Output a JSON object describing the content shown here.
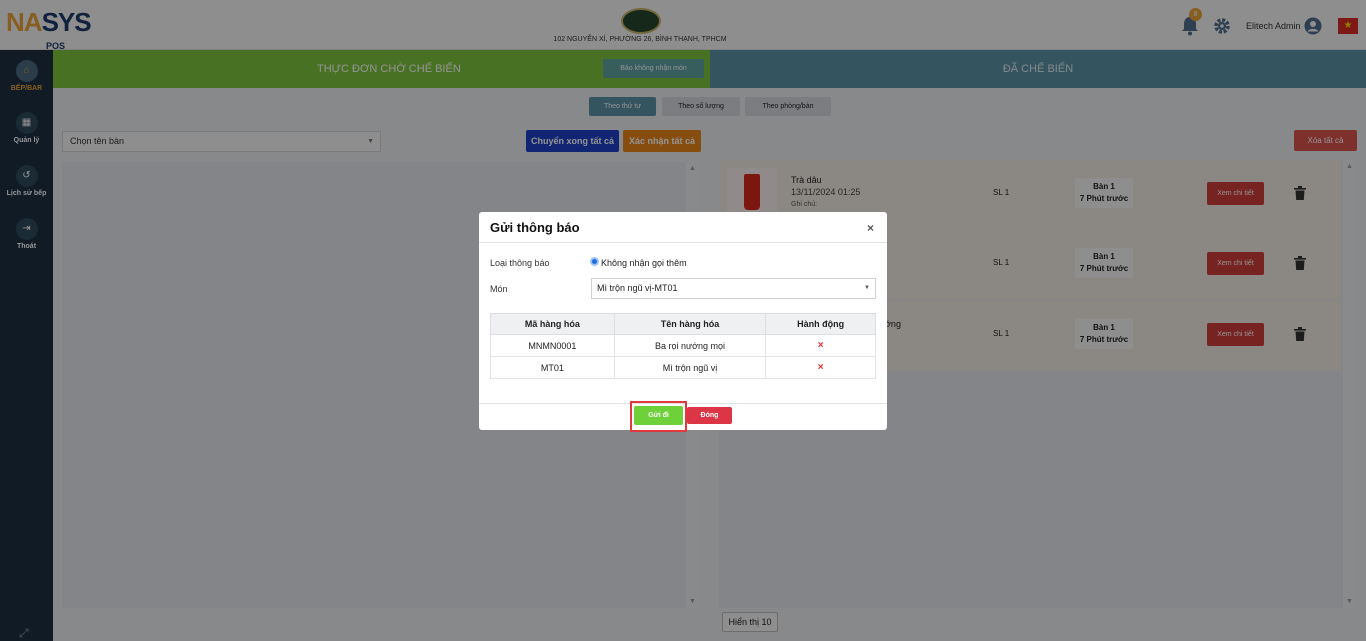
{
  "header": {
    "logo_part1": "NA",
    "logo_part2": "SYS",
    "logo_sub": "POS",
    "address": "102 NGUYỄN XÍ, PHƯỜNG 26, BÌNH THẠNH, TPHCM",
    "notification_count": "8",
    "user_name": "Elitech Admin",
    "flag_star": "★"
  },
  "sidebar": {
    "items": [
      {
        "label": "BẾP/BAR",
        "icon": "⌂"
      },
      {
        "label": "Quản lý",
        "icon": "▦"
      },
      {
        "label": "Lịch sử bếp",
        "icon": "↺"
      },
      {
        "label": "Thoát",
        "icon": "⇥"
      }
    ],
    "expand_icon": "⤢"
  },
  "tabs": {
    "pending_title": "THỰC ĐƠN CHỜ CHẾ BIẾN",
    "report_button": "Báo không nhận món",
    "done_title": "ĐÃ CHẾ BIẾN"
  },
  "sub_tabs": [
    "Theo thứ tự",
    "Theo số lượng",
    "Theo phòng/bàn"
  ],
  "toolbar": {
    "table_select_placeholder": "Chọn tên bàn",
    "done_all": "Chuyển xong tất cả",
    "confirm_all": "Xác nhận tất cả",
    "delete_all": "Xóa tất cả"
  },
  "orders": [
    {
      "name": "Trà dâu",
      "time": "13/11/2024 01:25",
      "note": "Ghi chú:",
      "qty": "SL 1",
      "table": "Bàn 1",
      "ago": "7 Phút trước",
      "detail": "Xem chi tiết"
    },
    {
      "name": "",
      "time": "",
      "note": "",
      "qty": "SL 1",
      "table": "Bàn 1",
      "ago": "7 Phút trước",
      "detail": "Xem chi tiết"
    },
    {
      "name": "nướng",
      "time": "",
      "note": "",
      "qty": "SL 1",
      "table": "Bàn 1",
      "ago": "7 Phút trước",
      "detail": "Xem chi tiết"
    }
  ],
  "pager": {
    "label": "Hiển thị 10"
  },
  "modal": {
    "title": "Gửi thông báo",
    "close_icon": "×",
    "type_label": "Loại thông báo",
    "type_option": "Không nhận gọi thêm",
    "dish_label": "Món",
    "dish_selected": "Mì trộn ngũ vị-MT01",
    "table_headers": [
      "Mã hàng hóa",
      "Tên hàng hóa",
      "Hành động"
    ],
    "rows": [
      {
        "code": "MNMN0001",
        "name": "Ba rọi nướng mọi",
        "action": "×"
      },
      {
        "code": "MT01",
        "name": "Mì trộn ngũ vị",
        "action": "×"
      }
    ],
    "send_button": "Gửi đi",
    "close_button": "Đóng"
  }
}
